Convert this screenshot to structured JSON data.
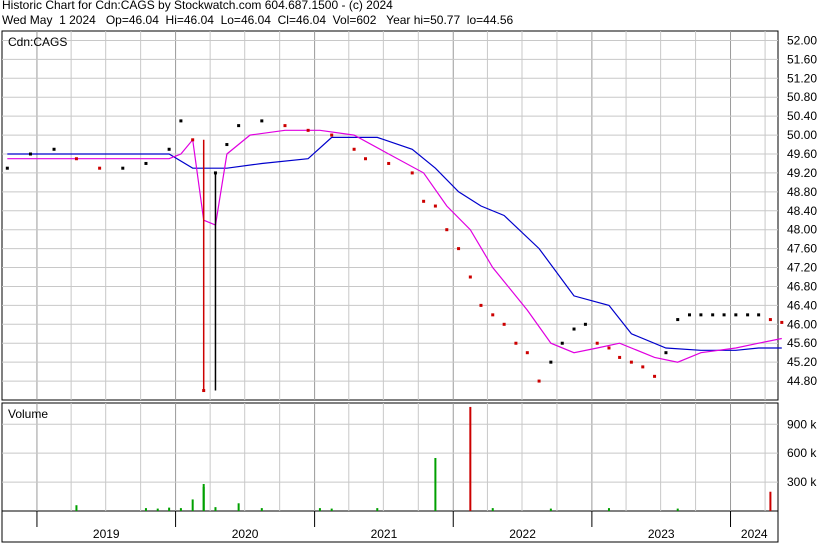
{
  "header": {
    "line1": "Historic Chart for Cdn:CAGS by Stockwatch.com 604.687.1500 - (c) 2024",
    "line2": "Wed May  1 2024   Op=46.04  Hi=46.04  Lo=46.04  Cl=46.04  Vol=602   Year hi=50.77  lo=44.56"
  },
  "colors": {
    "price_up": "#000000",
    "price_down": "#cc0000",
    "ma_long": "#0000cc",
    "ma_short": "#e000e0",
    "volume_up": "#00a000",
    "volume_down": "#cc0000",
    "grid": "#c8c8c8"
  },
  "chart_data": [
    {
      "type": "line",
      "title": "Cdn:CAGS",
      "x_axis": "date",
      "years": [
        "2019",
        "2020",
        "2021",
        "2022",
        "2023",
        "2024"
      ],
      "y_ticks": [
        "52.00",
        "51.60",
        "51.20",
        "50.80",
        "50.40",
        "50.00",
        "49.60",
        "49.20",
        "48.80",
        "48.40",
        "48.00",
        "47.60",
        "47.20",
        "46.80",
        "46.40",
        "46.00",
        "45.60",
        "45.20",
        "44.80"
      ],
      "ylim": [
        44.4,
        52.2
      ],
      "series": [
        {
          "name": "",
          "role": "price",
          "x": [
            "2018-10",
            "2018-12",
            "2019-02",
            "2019-04",
            "2019-06",
            "2019-08",
            "2019-10",
            "2019-12",
            "2020-01",
            "2020-02",
            "2020-03",
            "2020-04",
            "2020-05",
            "2020-06",
            "2020-08",
            "2020-10",
            "2020-12",
            "2021-02",
            "2021-04",
            "2021-05",
            "2021-07",
            "2021-09",
            "2021-10",
            "2021-11",
            "2021-12",
            "2022-01",
            "2022-02",
            "2022-03",
            "2022-04",
            "2022-05",
            "2022-06",
            "2022-07",
            "2022-08",
            "2022-09",
            "2022-10",
            "2022-11",
            "2022-12",
            "2023-01",
            "2023-02",
            "2023-03",
            "2023-04",
            "2023-05",
            "2023-06",
            "2023-07",
            "2023-08",
            "2023-09",
            "2023-10",
            "2023-11",
            "2023-12",
            "2024-01",
            "2024-02",
            "2024-03",
            "2024-04",
            "2024-05"
          ],
          "y": [
            49.3,
            49.6,
            49.7,
            49.5,
            49.3,
            49.3,
            49.4,
            49.7,
            50.3,
            49.9,
            44.6,
            49.2,
            49.8,
            50.2,
            50.3,
            50.2,
            50.1,
            50.0,
            49.7,
            49.5,
            49.4,
            49.2,
            48.6,
            48.5,
            48.0,
            47.6,
            47.0,
            46.4,
            46.2,
            46.0,
            45.6,
            45.4,
            44.8,
            45.2,
            45.6,
            45.9,
            46.0,
            45.6,
            45.5,
            45.3,
            45.2,
            45.1,
            44.9,
            45.4,
            46.1,
            46.2,
            46.2,
            46.2,
            46.2,
            46.2,
            46.2,
            46.2,
            46.1,
            46.04
          ]
        },
        {
          "name": "",
          "role": "moving-average-long",
          "x": [
            "2018-10",
            "2019-06",
            "2019-12",
            "2020-02",
            "2020-05",
            "2020-08",
            "2020-12",
            "2021-02",
            "2021-06",
            "2021-09",
            "2021-11",
            "2022-01",
            "2022-03",
            "2022-05",
            "2022-08",
            "2022-11",
            "2023-02",
            "2023-04",
            "2023-07",
            "2023-10",
            "2024-01",
            "2024-03",
            "2024-05"
          ],
          "y": [
            49.6,
            49.6,
            49.6,
            49.3,
            49.3,
            49.4,
            49.5,
            49.95,
            49.95,
            49.7,
            49.3,
            48.8,
            48.5,
            48.3,
            47.6,
            46.6,
            46.4,
            45.8,
            45.5,
            45.45,
            45.45,
            45.5,
            45.5
          ]
        },
        {
          "name": "",
          "role": "moving-average-short",
          "x": [
            "2018-10",
            "2019-06",
            "2019-12",
            "2020-01",
            "2020-02",
            "2020-03",
            "2020-04",
            "2020-05",
            "2020-07",
            "2020-10",
            "2021-01",
            "2021-04",
            "2021-07",
            "2021-10",
            "2021-12",
            "2022-02",
            "2022-04",
            "2022-07",
            "2022-09",
            "2022-11",
            "2023-01",
            "2023-03",
            "2023-06",
            "2023-08",
            "2023-10",
            "2024-01",
            "2024-03",
            "2024-05"
          ],
          "y": [
            49.5,
            49.5,
            49.5,
            49.6,
            49.9,
            48.2,
            48.1,
            49.6,
            50.0,
            50.1,
            50.1,
            50.0,
            49.6,
            49.2,
            48.5,
            48.0,
            47.2,
            46.3,
            45.6,
            45.4,
            45.5,
            45.6,
            45.3,
            45.2,
            45.4,
            45.5,
            45.6,
            45.7
          ]
        }
      ]
    },
    {
      "type": "bar",
      "title": "Volume",
      "y_ticks": [
        "900 k",
        "600 k",
        "300 k"
      ],
      "ylim": [
        0,
        1100000
      ],
      "x": [
        "2019-04",
        "2019-10",
        "2019-11",
        "2019-12",
        "2020-01",
        "2020-02",
        "2020-03",
        "2020-03",
        "2020-04",
        "2020-06",
        "2020-08",
        "2021-01",
        "2021-02",
        "2021-06",
        "2021-11",
        "2022-02",
        "2022-04",
        "2022-09",
        "2023-02",
        "2023-08",
        "2024-04"
      ],
      "values": [
        60000,
        30000,
        25000,
        35000,
        30000,
        120000,
        280000,
        250000,
        40000,
        80000,
        30000,
        30000,
        25000,
        30000,
        550000,
        1080000,
        30000,
        25000,
        30000,
        25000,
        200000
      ],
      "direction": [
        "up",
        "up",
        "up",
        "up",
        "up",
        "up",
        "up",
        "up",
        "up",
        "up",
        "up",
        "up",
        "up",
        "up",
        "up",
        "down",
        "up",
        "up",
        "up",
        "up",
        "down"
      ]
    }
  ]
}
